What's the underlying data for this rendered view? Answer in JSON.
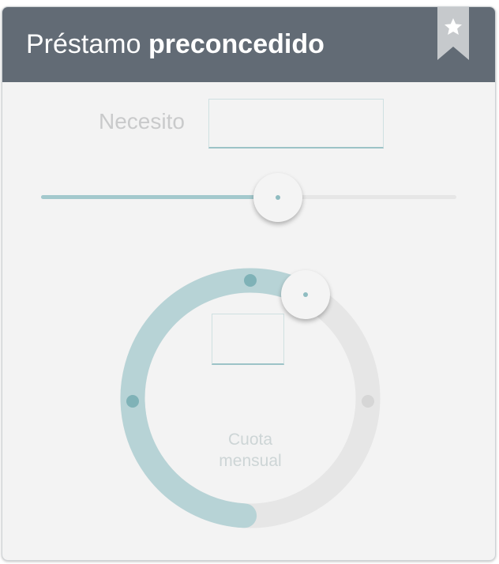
{
  "header": {
    "title_light": "Préstamo",
    "title_bold": "preconcedido",
    "bookmark_icon": "star-bookmark-icon"
  },
  "amount": {
    "label": "Necesito",
    "value": "",
    "placeholder": ""
  },
  "amount_slider": {
    "level_fraction": 0.57
  },
  "monthly_dial": {
    "label_line1": "Cuota",
    "label_line2": "mensual",
    "value": "",
    "level_fraction": 0.57
  },
  "colors": {
    "header_bg": "#626b75",
    "accent": "#a3c9cd",
    "accent_dot": "#7fb2b7",
    "track": "#e6e6e6",
    "card_bg": "#f3f3f3",
    "muted_text": "#c9cacb"
  }
}
